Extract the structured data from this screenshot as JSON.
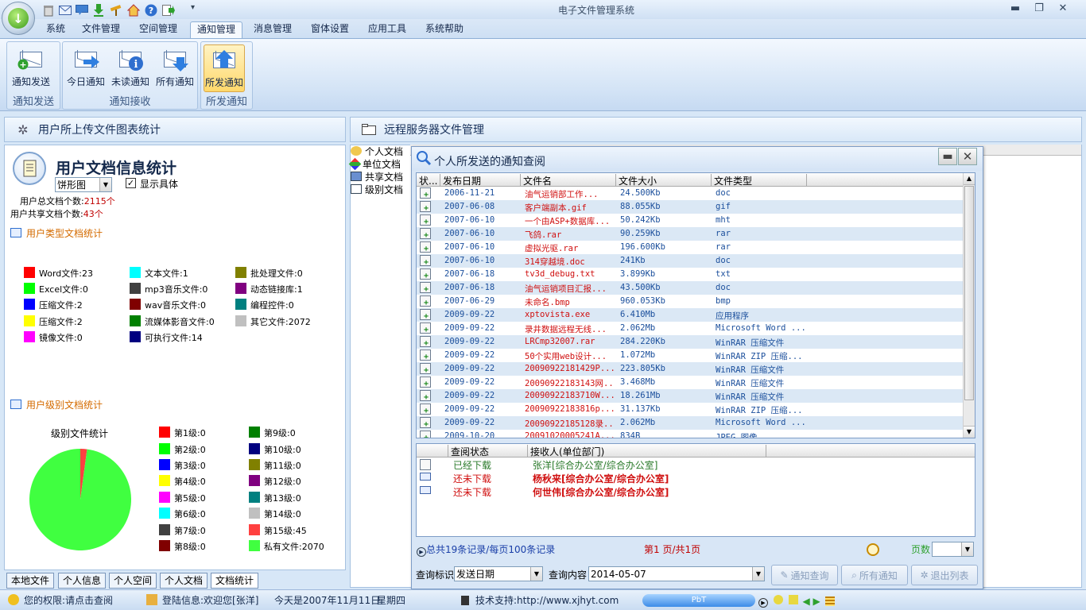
{
  "window": {
    "title": "电子文件管理系统",
    "min": "▬",
    "max": "❐",
    "close": "✕"
  },
  "quick_access": [
    "delete-icon",
    "mail-icon",
    "message-icon",
    "download-icon",
    "tool-icon",
    "home-icon",
    "help-icon",
    "exit-icon"
  ],
  "menu": [
    "系统",
    "文件管理",
    "空间管理",
    "通知管理",
    "消息管理",
    "窗体设置",
    "应用工具",
    "系统帮助"
  ],
  "ribbon": {
    "groups": [
      {
        "label": "通知发送",
        "buttons": [
          "通知发送"
        ]
      },
      {
        "label": "通知接收",
        "buttons": [
          "今日通知",
          "未读通知",
          "所有通知"
        ]
      },
      {
        "label": "所发通知",
        "buttons": [
          "所发通知"
        ]
      }
    ]
  },
  "left": {
    "header": "用户所上传文件图表统计",
    "stat_title": "用户文档信息统计",
    "chart_type": "饼形图",
    "show_detail": "显示具体",
    "total_label": "用户总文档个数:",
    "total_value": "2115个",
    "shared_label": "用户共享文档个数:",
    "shared_value": "43个",
    "type_section": "用户类型文档统计",
    "level_section": "用户级别文档统计",
    "type_legend": [
      {
        "label": "Word文件:23",
        "color": "#ff0000"
      },
      {
        "label": "文本文件:1",
        "color": "#00ffff"
      },
      {
        "label": "批处理文件:0",
        "color": "#808000"
      },
      {
        "label": "Excel文件:0",
        "color": "#00ff00"
      },
      {
        "label": "mp3音乐文件:0",
        "color": "#404040"
      },
      {
        "label": "动态链接库:1",
        "color": "#800080"
      },
      {
        "label": "压缩文件:2",
        "color": "#0000ff"
      },
      {
        "label": "wav音乐文件:0",
        "color": "#800000"
      },
      {
        "label": "编程控件:0",
        "color": "#008080"
      },
      {
        "label": "压缩文件:2",
        "color": "#ffff00"
      },
      {
        "label": "流媒体影音文件:0",
        "color": "#008000"
      },
      {
        "label": "其它文件:2072",
        "color": "#c0c0c0"
      },
      {
        "label": "镜像文件:0",
        "color": "#ff00ff"
      },
      {
        "label": "可执行文件:14",
        "color": "#000080"
      }
    ],
    "level_legend": [
      {
        "label": "第1级:0",
        "color": "#ff0000"
      },
      {
        "label": "第9级:0",
        "color": "#008000"
      },
      {
        "label": "第2级:0",
        "color": "#00ff00"
      },
      {
        "label": "第10级:0",
        "color": "#000080"
      },
      {
        "label": "第3级:0",
        "color": "#0000ff"
      },
      {
        "label": "第11级:0",
        "color": "#808000"
      },
      {
        "label": "第4级:0",
        "color": "#ffff00"
      },
      {
        "label": "第12级:0",
        "color": "#800080"
      },
      {
        "label": "第5级:0",
        "color": "#ff00ff"
      },
      {
        "label": "第13级:0",
        "color": "#008080"
      },
      {
        "label": "第6级:0",
        "color": "#00ffff"
      },
      {
        "label": "第14级:0",
        "color": "#c0c0c0"
      },
      {
        "label": "第7级:0",
        "color": "#404040"
      },
      {
        "label": "第15级:45",
        "color": "#ff4040"
      },
      {
        "label": "第8级:0",
        "color": "#800000"
      },
      {
        "label": "私有文件:2070",
        "color": "#40ff40"
      }
    ],
    "bottom_tabs": [
      "本地文件",
      "个人信息",
      "个人空间",
      "个人文档",
      "文档统计"
    ]
  },
  "chart_data": {
    "type": "pie",
    "title": "级别文件统计",
    "categories": [
      "第15级",
      "私有文件"
    ],
    "values": [
      45,
      2070
    ],
    "colors": [
      "#ff4040",
      "#40ff40"
    ]
  },
  "right": {
    "header": "远程服务器文件管理",
    "tree": [
      "个人文档",
      "单位文档",
      "共享文档",
      "级别文档"
    ]
  },
  "dialog": {
    "title": "个人所发送的通知查阅",
    "columns": [
      "状...",
      "发布日期",
      "文件名",
      "文件大小",
      "文件类型"
    ],
    "rows": [
      {
        "date": "2006-11-21",
        "name": "油气运销部工作...",
        "size": "24.500Kb",
        "type": "doc"
      },
      {
        "date": "2007-06-08",
        "name": "客户端副本.gif",
        "size": "88.055Kb",
        "type": "gif"
      },
      {
        "date": "2007-06-10",
        "name": "一个由ASP+数据库...",
        "size": "50.242Kb",
        "type": "mht"
      },
      {
        "date": "2007-06-10",
        "name": "飞鸽.rar",
        "size": "90.259Kb",
        "type": "rar"
      },
      {
        "date": "2007-06-10",
        "name": "虚拟光驱.rar",
        "size": "196.600Kb",
        "type": "rar"
      },
      {
        "date": "2007-06-10",
        "name": "314穿越境.doc",
        "size": " 241Kb",
        "type": "doc"
      },
      {
        "date": "2007-06-18",
        "name": "tv3d_debug.txt",
        "size": "3.899Kb",
        "type": "txt"
      },
      {
        "date": "2007-06-18",
        "name": "油气运销项目汇报...",
        "size": "43.500Kb",
        "type": "doc"
      },
      {
        "date": "2007-06-29",
        "name": "未命名.bmp",
        "size": "960.053Kb",
        "type": "bmp"
      },
      {
        "date": "2009-09-22",
        "name": "xptovista.exe",
        "size": "6.410Mb",
        "type": "应用程序"
      },
      {
        "date": "2009-09-22",
        "name": "录井数据远程无线...",
        "size": "2.062Mb",
        "type": "Microsoft Word ..."
      },
      {
        "date": "2009-09-22",
        "name": "LRCmp32007.rar",
        "size": "284.220Kb",
        "type": "WinRAR 压缩文件"
      },
      {
        "date": "2009-09-22",
        "name": "50个实用web设计...",
        "size": "1.072Mb",
        "type": "WinRAR ZIP 压缩..."
      },
      {
        "date": "2009-09-22",
        "name": "20090922181429P...",
        "size": "223.805Kb",
        "type": "WinRAR 压缩文件"
      },
      {
        "date": "2009-09-22",
        "name": "20090922183143网...",
        "size": "3.468Mb",
        "type": "WinRAR 压缩文件"
      },
      {
        "date": "2009-09-22",
        "name": "20090922183710W...",
        "size": "18.261Mb",
        "type": "WinRAR 压缩文件"
      },
      {
        "date": "2009-09-22",
        "name": "20090922183816p...",
        "size": "31.137Kb",
        "type": "WinRAR ZIP 压缩..."
      },
      {
        "date": "2009-09-22",
        "name": "20090922185128录...",
        "size": "2.062Mb",
        "type": "Microsoft Word ..."
      },
      {
        "date": "2009-10-20",
        "name": "20091020005241A...",
        "size": "834B",
        "type": "JPEG 图像"
      }
    ],
    "recv_columns": [
      "查阅状态",
      "接收人(单位部门)"
    ],
    "recv_rows": [
      {
        "status": "已经下载",
        "person": "张洋[综合办公室/综合办公室]",
        "kind": "done"
      },
      {
        "status": "还未下载",
        "person": "杨秋来[综合办公室/综合办公室]",
        "kind": "pending"
      },
      {
        "status": "还未下载",
        "person": "何世伟[综合办公室/综合办公室]",
        "kind": "pending"
      }
    ],
    "summary": "总共19条记录/每页100条记录",
    "page_info": "第1 页/共1页",
    "page_label": "页数",
    "query_label": "查询标识",
    "query_field": "发送日期",
    "content_label": "查询内容",
    "content_value": "2014-05-07",
    "btn_query": "通知查询",
    "btn_all": "所有通知",
    "btn_exit": "退出列表"
  },
  "status": {
    "rights": "您的权限:请点击查阅",
    "login": "登陆信息:欢迎您[张洋]",
    "date": "今天是2007年11月11日",
    "weekday": "星期四",
    "support": "技术支持:http://www.xjhyt.com",
    "pbt": "PbT"
  }
}
